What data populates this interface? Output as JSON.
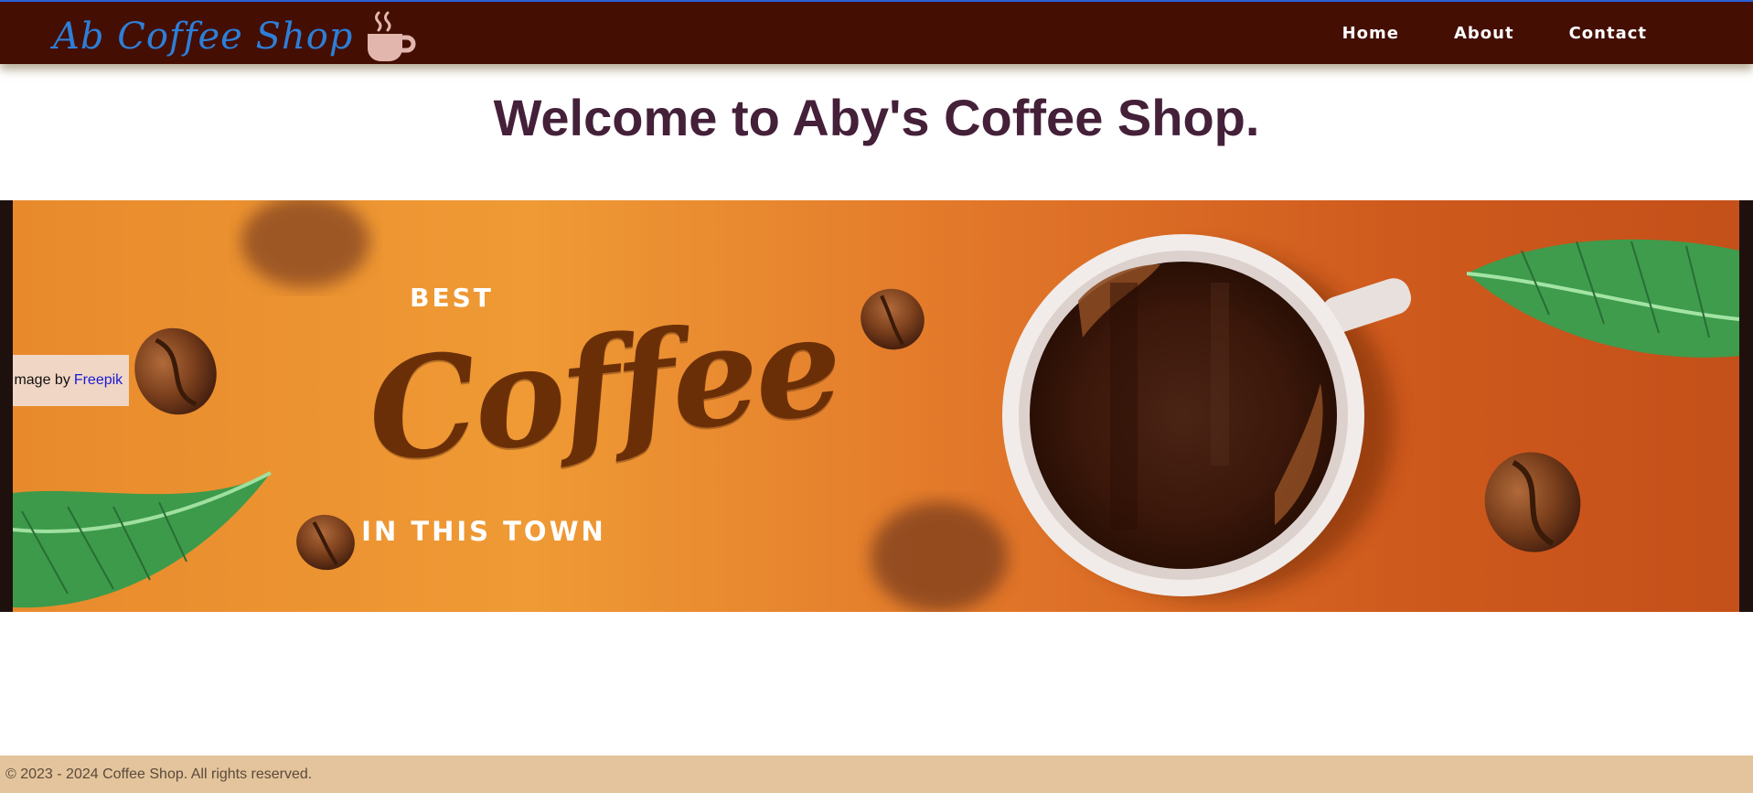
{
  "header": {
    "brand": "Ab Coffee Shop",
    "brand_icon": "coffee-cup-icon",
    "nav": [
      {
        "label": "Home"
      },
      {
        "label": "About"
      },
      {
        "label": "Contact"
      }
    ]
  },
  "main": {
    "title": "Welcome to Aby's Coffee Shop.",
    "hero": {
      "line1": "BEST",
      "line2": "Coffee",
      "line3": "IN THIS TOWN"
    },
    "credit": {
      "prefix": "Image by",
      "link_text": "Freepik"
    }
  },
  "footer": {
    "text": "© 2023 - 2024 Coffee Shop. All rights reserved."
  },
  "colors": {
    "navbar": "#440e03",
    "brand_text": "#2d7fd8",
    "title": "#442039",
    "footer": "#e4c49c"
  }
}
